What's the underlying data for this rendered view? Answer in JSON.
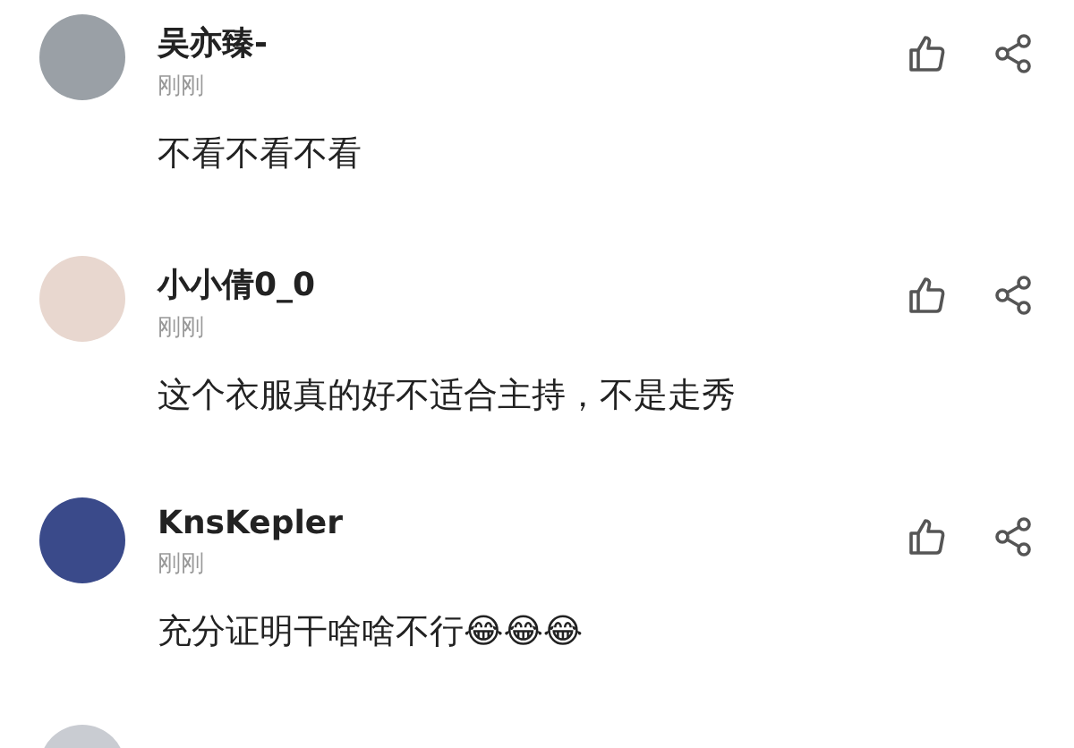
{
  "comments": [
    {
      "user": "吴亦臻-",
      "time": "刚刚",
      "text": "不看不看不看"
    },
    {
      "user": "小小倩0_0",
      "time": "刚刚",
      "text": "这个衣服真的好不适合主持，不是走秀"
    },
    {
      "user": "KnsKepler",
      "time": "刚刚",
      "text": "充分证明干啥啥不行😂😂😂"
    }
  ]
}
